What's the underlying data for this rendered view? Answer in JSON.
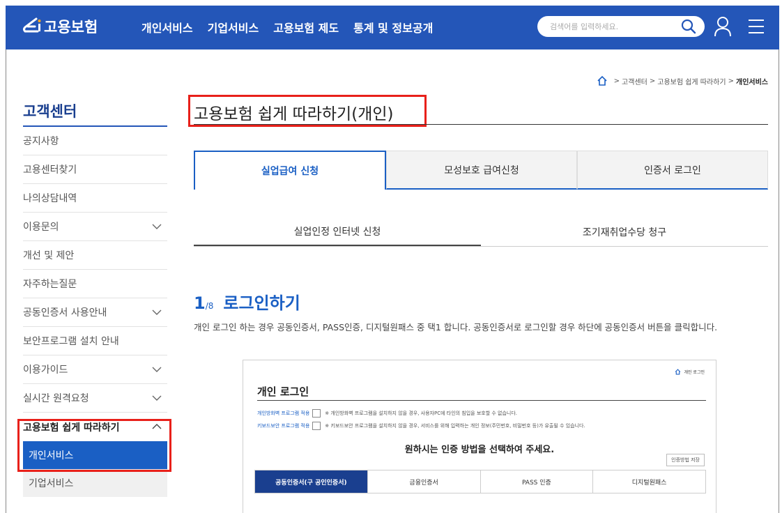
{
  "header": {
    "logo_text": "고용보험",
    "nav": [
      "개인서비스",
      "기업서비스",
      "고용보험 제도",
      "통계 및 정보공개"
    ],
    "search_placeholder": "검색어를 입력하세요.",
    "bg_color": "#2456b8"
  },
  "breadcrumb": {
    "items": [
      "고객센터",
      "고용보험 쉽게 따라하기"
    ],
    "current": "개인서비스",
    "separator": ">"
  },
  "sidebar": {
    "title": "고객센터",
    "items": [
      {
        "label": "공지사항",
        "expandable": false
      },
      {
        "label": "고용센터찾기",
        "expandable": false
      },
      {
        "label": "나의상담내역",
        "expandable": false
      },
      {
        "label": "이용문의",
        "expandable": true
      },
      {
        "label": "개선 및 제안",
        "expandable": false
      },
      {
        "label": "자주하는질문",
        "expandable": false
      },
      {
        "label": "공동인증서 사용안내",
        "expandable": true
      },
      {
        "label": "보안프로그램 설치 안내",
        "expandable": false
      },
      {
        "label": "이용가이드",
        "expandable": true
      },
      {
        "label": "실시간 원격요청",
        "expandable": true
      },
      {
        "label": "고용보험 쉽게 따라하기",
        "expandable": true,
        "open": true
      }
    ],
    "sub_items": [
      {
        "label": "개인서비스",
        "active": true
      },
      {
        "label": "기업서비스",
        "active": false
      }
    ]
  },
  "page": {
    "title": "고용보험 쉽게 따라하기(개인)",
    "tabs": [
      {
        "label": "실업급여 신청",
        "active": true
      },
      {
        "label": "모성보호 급여신청",
        "active": false
      },
      {
        "label": "인증서 로그인",
        "active": false
      }
    ],
    "subtabs": [
      {
        "label": "실업인정 인터넷 신청",
        "active": true
      },
      {
        "label": "조기재취업수당 청구",
        "active": false
      }
    ],
    "step": {
      "num": "1",
      "total": "/8",
      "title": "로그인하기",
      "desc": "개인 로그인 하는 경우 공동인증서, PASS인증, 디지털원패스 중 택1 합니다. 공동인증서로 로그인할 경우 하단에 공동인증서 버튼을 클릭합니다."
    }
  },
  "panel": {
    "home_label": "개인 로그인",
    "title": "개인 로그인",
    "option1_label": "개인방화벽 프로그램 적용",
    "option1_note": "※ 개인방화벽 프로그램을 설치하지 않을 경우, 사용자PC에 타인의 침입을 보호할 수 없습니다.",
    "option2_label": "키보드보안 프로그램 적용",
    "option2_note": "※ 키보드보안 프로그램을 설치하지 않을 경우, 서비스를 위해 입력하는 개인 정보(주민번호, 비밀번호 등)가 유출될 수 있습니다.",
    "prompt": "원하시는 인증 방법을 선택하여 주세요.",
    "save_button": "인증방법 저장",
    "auth_tabs": [
      {
        "label": "공동인증서(구 공인인증서)",
        "active": true
      },
      {
        "label": "금융인증서",
        "active": false
      },
      {
        "label": "PASS 인증",
        "active": false
      },
      {
        "label": "디지털원패스",
        "active": false
      }
    ]
  },
  "colors": {
    "primary": "#2456b8",
    "active_blue": "#1a5fc4",
    "highlight_red": "#e8201a"
  }
}
